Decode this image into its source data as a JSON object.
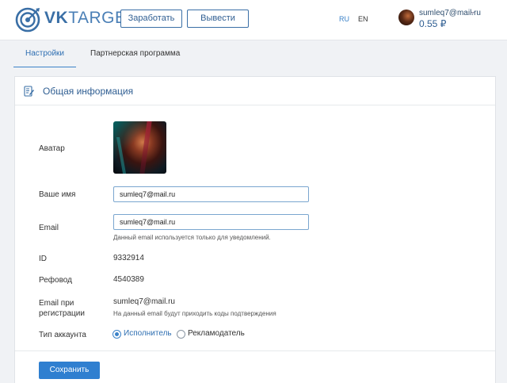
{
  "header": {
    "logo_vk": "VK",
    "logo_target": "TARGET",
    "btn_earn": "Заработать",
    "btn_withdraw": "Вывести",
    "lang_ru": "RU",
    "lang_en": "EN",
    "user_email": "sumleq7@mail.ru",
    "chevron": "⌄",
    "balance": "0.55 ₽"
  },
  "tabs": {
    "settings": "Настройки",
    "partner": "Партнерская программа"
  },
  "panel": {
    "title": "Общая информация",
    "avatar_label": "Аватар",
    "name_label": "Ваше имя",
    "name_value": "sumleq7@mail.ru",
    "email_label": "Email",
    "email_value": "sumleq7@mail.ru",
    "email_hint": "Данный email используется только для уведомлений.",
    "id_label": "ID",
    "id_value": "9332914",
    "ref_label": "Рефовод",
    "ref_value": "4540389",
    "reg_email_label_1": "Email при",
    "reg_email_label_2": "регистрации",
    "reg_email_value": "sumleq7@mail.ru",
    "reg_email_hint": "На данный email будут приходить коды подтверждения",
    "account_type_label": "Тип аккаунта",
    "account_type_options": [
      "Исполнитель",
      "Рекламодатель"
    ],
    "account_type_selected": "Исполнитель",
    "save_label": "Сохранить"
  },
  "colors": {
    "accent": "#3b82c8",
    "brand": "#3a6fa6",
    "save_button": "#2f7fd0"
  },
  "icons": [
    "target-logo-icon",
    "user-avatar",
    "chevron-down-icon",
    "edit-document-icon"
  ]
}
